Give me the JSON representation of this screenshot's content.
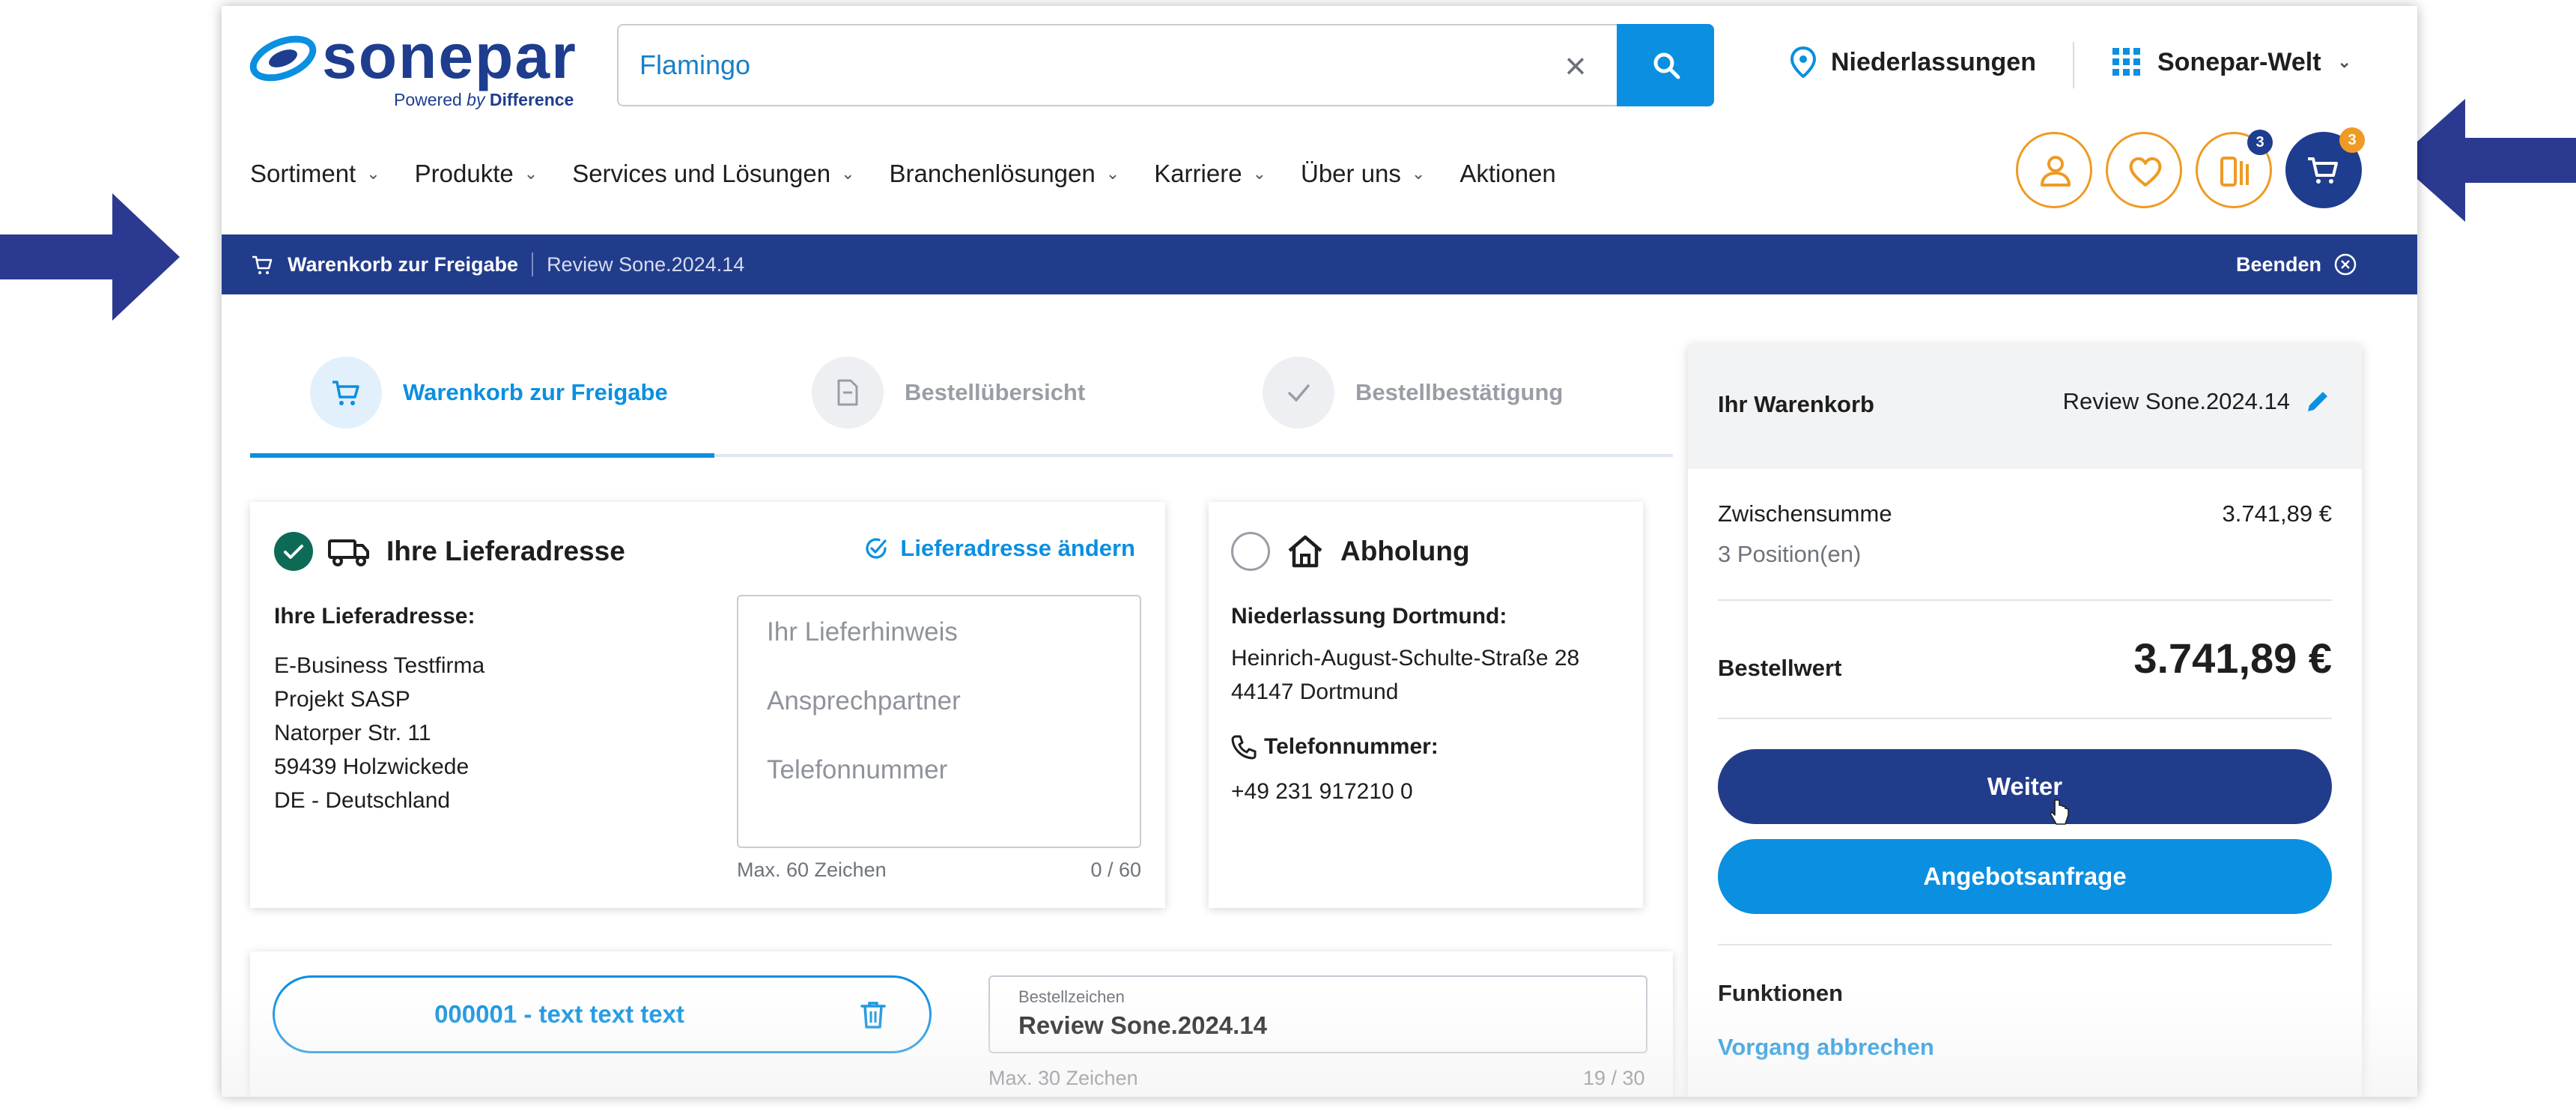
{
  "header": {
    "logo_text": "sonepar",
    "logo_tagline_prefix": "Powered",
    "logo_tagline_by": "by",
    "logo_tagline_brand": "Difference",
    "search_value": "Flamingo",
    "branches_label": "Niederlassungen",
    "world_label": "Sonepar-Welt",
    "compare_count": "3",
    "cart_count": "3"
  },
  "nav": {
    "items": [
      "Sortiment",
      "Produkte",
      "Services und Lösungen",
      "Branchenlösungen",
      "Karriere",
      "Über uns",
      "Aktionen"
    ]
  },
  "banner": {
    "title": "Warenkorb zur Freigabe",
    "reference": "Review Sone.2024.14",
    "end_label": "Beenden"
  },
  "steps": [
    "Warenkorb zur Freigabe",
    "Bestellübersicht",
    "Bestellbestätigung"
  ],
  "delivery": {
    "title": "Ihre Lieferadresse",
    "change_link": "Lieferadresse ändern",
    "address_label": "Ihre Lieferadresse:",
    "address_lines": [
      "E-Business Testfirma",
      "Projekt SASP",
      "Natorper Str. 11",
      "59439 Holzwickede",
      "DE - Deutschland"
    ],
    "hint_placeholder_lines": [
      "Ihr Lieferhinweis",
      "Ansprechpartner",
      "Telefonnummer"
    ],
    "hint_max": "Max. 60 Zeichen",
    "hint_count": "0 / 60"
  },
  "pickup": {
    "title": "Abholung",
    "branch_label": "Niederlassung Dortmund:",
    "address_lines": [
      "Heinrich-August-Schulte-Straße 28",
      "44147 Dortmund"
    ],
    "phone_label": "Telefonnummer:",
    "phone": "+49 231 917210 0"
  },
  "summary": {
    "title": "Ihr Warenkorb",
    "reference": "Review Sone.2024.14",
    "subtotal_label": "Zwischensumme",
    "subtotal_value": "3.741,89 €",
    "positions": "3 Position(en)",
    "order_value_label": "Bestellwert",
    "order_value": "3.741,89 €",
    "next_button": "Weiter",
    "quote_button": "Angebotsanfrage",
    "functions_label": "Funktionen",
    "cancel_link": "Vorgang abbrechen"
  },
  "item": {
    "pill_label": "000001 - text text text",
    "order_ref_label": "Bestellzeichen",
    "order_ref_value": "Review Sone.2024.14",
    "order_ref_max": "Max. 30 Zeichen",
    "order_ref_count": "19 / 30"
  },
  "colors": {
    "brand_dark": "#223c8c",
    "brand_blue": "#0b8fe0",
    "accent_orange": "#ef9a23",
    "check_green": "#0d6b55",
    "arrow": "#2b3990"
  }
}
